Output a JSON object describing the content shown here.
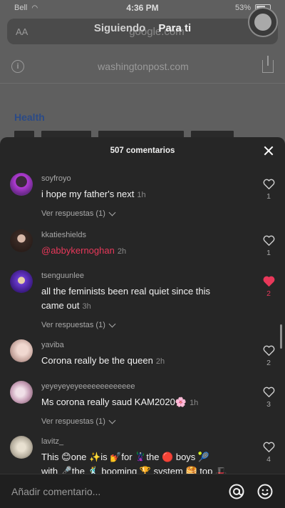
{
  "status_bar": {
    "carrier": "Bell",
    "time": "4:36 PM",
    "battery": "53%"
  },
  "feed_tabs": {
    "following": "Siguiendo",
    "for_you": "Para ti"
  },
  "browser": {
    "aa_label": "AA",
    "address": "google.com",
    "site_url": "washingtonpost.com"
  },
  "article": {
    "section": "Health"
  },
  "comments_sheet": {
    "title": "507 comentarios",
    "comments": [
      {
        "user": "soyfroyo",
        "text": "i hope my father's next",
        "time": "1h",
        "likes": "1",
        "liked": false,
        "replies": "Ver respuestas (1)"
      },
      {
        "user": "kkatieshields",
        "mention": "@abbykernoghan",
        "time": "2h",
        "likes": "1",
        "liked": false
      },
      {
        "user": "tsenguunlee",
        "text_line1": "all the feminists been real quiet since this",
        "text_line2": "came out",
        "time": "3h",
        "likes": "2",
        "liked": true,
        "replies": "Ver respuestas (1)"
      },
      {
        "user": "yaviba",
        "text": "Corona really be the queen",
        "time": "2h",
        "likes": "2",
        "liked": false
      },
      {
        "user": "yeyeyeyeyeeeeeeeeeeeee",
        "text": "Ms corona really saud KAM2020🌸",
        "time": "1h",
        "likes": "3",
        "liked": false,
        "replies": "Ver respuestas (1)"
      },
      {
        "user": "lavitz_",
        "text_line1": "This 😊one ✨is 💅for 🦹the 🔴 boys 🎾",
        "text_line2": "with 🎤the 🕺 booming 🏆 system 🥞 top 🎩",
        "likes": "4",
        "liked": false
      }
    ]
  },
  "input_bar": {
    "placeholder": "Añadir comentario..."
  },
  "colors": {
    "accent_red": "#e8385a",
    "sheet_bg": "#262626"
  }
}
